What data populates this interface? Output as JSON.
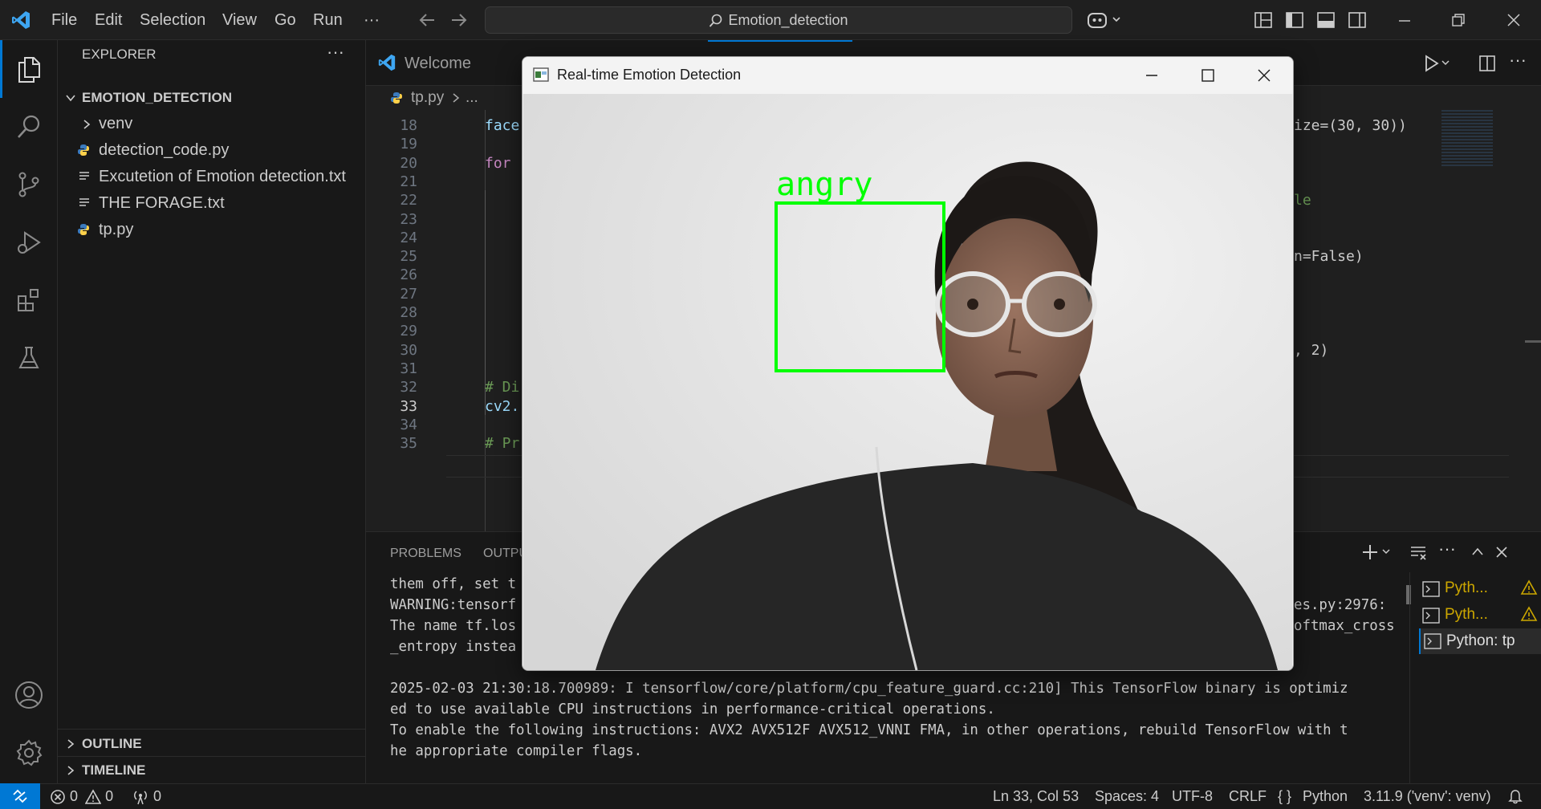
{
  "menu": [
    "File",
    "Edit",
    "Selection",
    "View",
    "Go",
    "Run",
    "···"
  ],
  "search": {
    "text": "Emotion_detection"
  },
  "explorer": {
    "title": "EXPLORER",
    "more": "···",
    "folder": "EMOTION_DETECTION",
    "items": [
      {
        "name": "venv",
        "kind": "folder"
      },
      {
        "name": "detection_code.py",
        "kind": "python"
      },
      {
        "name": "Excutetion of Emotion detection.txt",
        "kind": "text"
      },
      {
        "name": "THE FORAGE.txt",
        "kind": "text"
      },
      {
        "name": "tp.py",
        "kind": "python"
      }
    ],
    "outline": "OUTLINE",
    "timeline": "TIMELINE"
  },
  "tabs": {
    "welcome": "Welcome",
    "breadcrumb_file": "tp.py",
    "breadcrumb_more": "..."
  },
  "editor": {
    "lines": [
      {
        "n": "18",
        "code": "face",
        "right": "ize=(30, 30))"
      },
      {
        "n": "19",
        "code": "",
        "right": ""
      },
      {
        "n": "20",
        "code": "for",
        "right": ""
      },
      {
        "n": "21",
        "code": "",
        "right": ""
      },
      {
        "n": "22",
        "code": "",
        "right": "le"
      },
      {
        "n": "23",
        "code": "",
        "right": ""
      },
      {
        "n": "24",
        "code": "",
        "right": ""
      },
      {
        "n": "25",
        "code": "",
        "right": "n=False)"
      },
      {
        "n": "26",
        "code": "",
        "right": ""
      },
      {
        "n": "27",
        "code": "",
        "right": ""
      },
      {
        "n": "28",
        "code": "",
        "right": ""
      },
      {
        "n": "29",
        "code": "",
        "right": ""
      },
      {
        "n": "30",
        "code": "",
        "right": ", 2)"
      },
      {
        "n": "31",
        "code": "",
        "right": ""
      },
      {
        "n": "32",
        "code": "# Di",
        "right": ""
      },
      {
        "n": "33",
        "code": "cv2.",
        "right": ""
      },
      {
        "n": "34",
        "code": "",
        "right": ""
      },
      {
        "n": "35",
        "code": "# Pr",
        "right": ""
      }
    ]
  },
  "panel": {
    "tab_problems": "PROBLEMS",
    "tab_output": "OUTPU",
    "terminal_lines": [
      {
        "left": "them off, set t",
        "right": ""
      },
      {
        "left": "WARNING:tensorf",
        "right": "es.py:2976:"
      },
      {
        "left": "The name tf.los",
        "right": "oftmax_cross"
      },
      {
        "left": "_entropy instea",
        "right": ""
      },
      {
        "left": "",
        "right": ""
      },
      {
        "left": "2025-02-03 21:30:18.700989: I tensorflow/core/platform/cpu_feature_guard.cc:210] This TensorFlow binary is optimiz",
        "right": ""
      },
      {
        "left": "ed to use available CPU instructions in performance-critical operations.",
        "right": ""
      },
      {
        "left": "To enable the following instructions: AVX2 AVX512F AVX512_VNNI FMA, in other operations, rebuild TensorFlow with t",
        "right": ""
      },
      {
        "left": "he appropriate compiler flags.",
        "right": ""
      }
    ],
    "terminals": [
      {
        "label": "Pyth...",
        "warn": true
      },
      {
        "label": "Pyth...",
        "warn": true
      },
      {
        "label": "Python: tp",
        "warn": false
      }
    ]
  },
  "window": {
    "title": "Real-time Emotion Detection",
    "emotion_label": "angry"
  },
  "status": {
    "errors": "0",
    "warnings": "0",
    "ports": "0",
    "position": "Ln 33, Col 53",
    "spaces": "Spaces: 4",
    "encoding": "UTF-8",
    "eol": "CRLF",
    "language": "Python",
    "interpreter": "3.11.9 ('venv': venv)",
    "braces": "{ }"
  },
  "colors": {
    "accent": "#0078d4",
    "box": "#00ff00",
    "keyword": "#c586c0",
    "variable": "#9cdcfe",
    "comment": "#6a9955",
    "warn": "#cca700",
    "folder_text": "#cccccc"
  }
}
